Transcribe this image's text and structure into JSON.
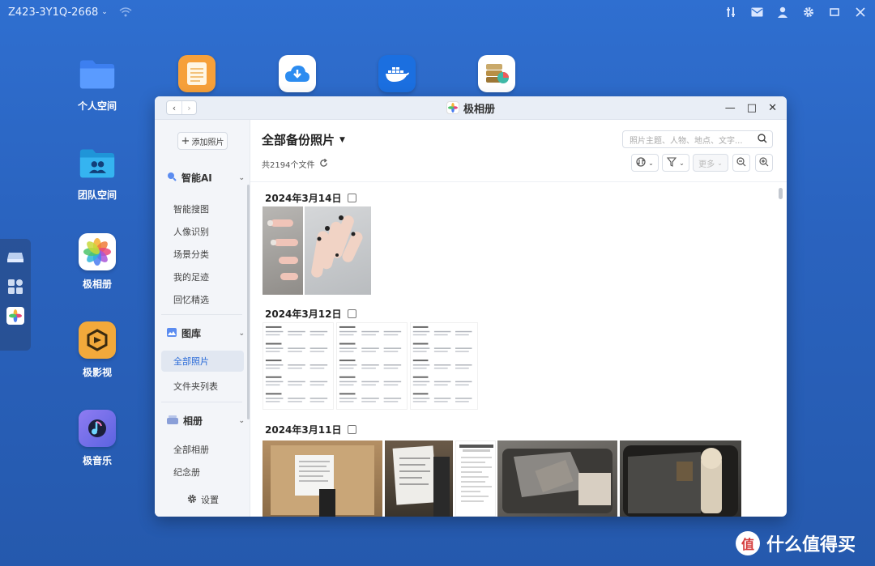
{
  "topbar": {
    "device_name": "Z423-3Y1Q-2668",
    "icons": [
      "tools-icon",
      "mail-icon",
      "user-icon",
      "gear-icon",
      "minimize-icon",
      "close-icon"
    ]
  },
  "desktop": {
    "apps": [
      {
        "label": "个人空间",
        "icon": "folder-icon"
      },
      {
        "label": "团队空间",
        "icon": "team-folder-icon"
      },
      {
        "label": "极相册",
        "icon": "photos-icon"
      },
      {
        "label": "极影视",
        "icon": "video-icon"
      },
      {
        "label": "极音乐",
        "icon": "music-icon"
      }
    ],
    "top_row_icons": [
      "notes-icon",
      "cloud-download-icon",
      "docker-icon",
      "database-icon"
    ]
  },
  "window": {
    "title": "极相册",
    "colors": {
      "accent": "#2a6bd8"
    }
  },
  "sidebar": {
    "add_button": "添加照片",
    "ai_section": {
      "title": "智能AI",
      "items": [
        "智能搜图",
        "人像识别",
        "场景分类",
        "我的足迹",
        "回忆精选"
      ]
    },
    "library_section": {
      "title": "图库",
      "items": [
        "全部照片",
        "文件夹列表"
      ],
      "active": "全部照片"
    },
    "album_section": {
      "title": "相册",
      "items": [
        "全部相册",
        "纪念册"
      ]
    },
    "settings": "设置"
  },
  "main": {
    "title": "全部备份照片",
    "file_count": "共2194个文件",
    "search_placeholder": "照片主题、人物、地点、文字...",
    "more_label": "更多",
    "groups": [
      {
        "date": "2024年3月14日"
      },
      {
        "date": "2024年3月12日"
      },
      {
        "date": "2024年3月11日"
      }
    ]
  },
  "watermark": {
    "badge": "值",
    "text": "什么值得买"
  }
}
